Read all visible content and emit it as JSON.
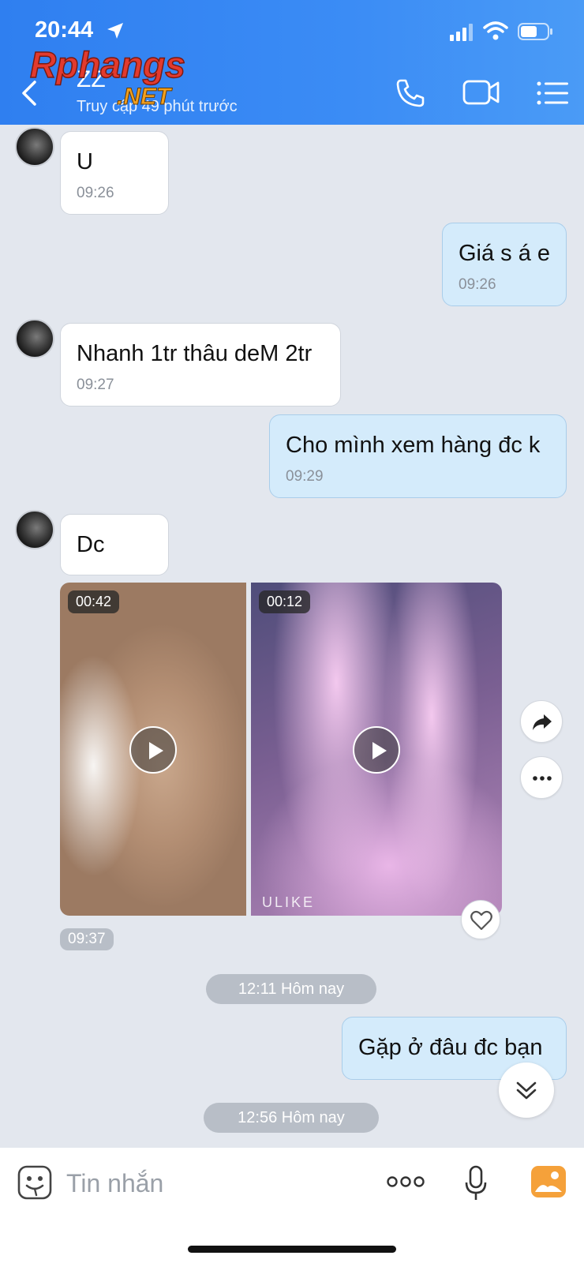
{
  "status_bar": {
    "time": "20:44"
  },
  "header": {
    "contact_name": "ZZ",
    "contact_status": "Truy cập 49 phút trước",
    "logo_text": "Rphangs.NET",
    "bg_color": "#3b8cf5"
  },
  "messages": [
    {
      "side": "in",
      "text": "U",
      "time": "09:26"
    },
    {
      "side": "out",
      "text": "Giá s á e",
      "time": "09:26"
    },
    {
      "side": "in",
      "text": "Nhanh 1tr thâu deM 2tr",
      "time": "09:27"
    },
    {
      "side": "out",
      "text": "Cho mình xem hàng đc k",
      "time": "09:29"
    },
    {
      "side": "in",
      "text": "Dc",
      "time": ""
    }
  ],
  "media": {
    "videos": [
      {
        "duration": "00:42"
      },
      {
        "duration": "00:12",
        "watermark": "ULIKE"
      }
    ],
    "time": "09:37"
  },
  "date_pills": [
    "12:11 Hôm nay",
    "12:56 Hôm nay"
  ],
  "last_message": {
    "side": "out",
    "text": "Gặp ở đâu đc bạn"
  },
  "input": {
    "placeholder": "Tin nhắn"
  },
  "colors": {
    "accent": "#3b8cf5",
    "out_bubble": "#d4ebfb",
    "in_bubble": "#ffffff",
    "gallery": "#f5a13a"
  }
}
